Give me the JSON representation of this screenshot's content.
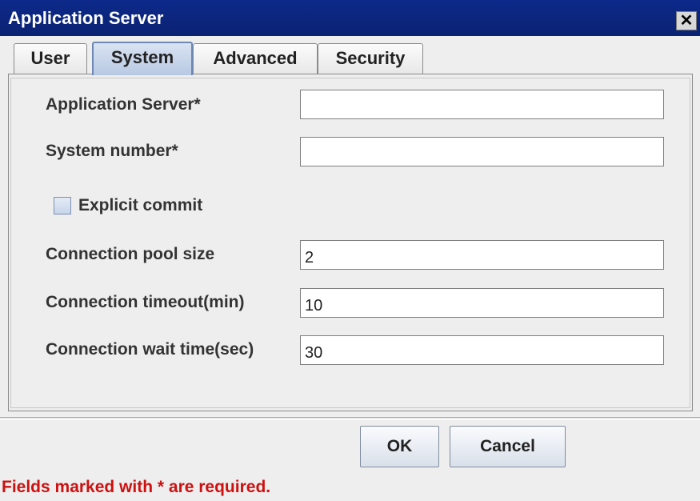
{
  "window": {
    "title": "Application Server",
    "close_glyph": "✕"
  },
  "tabs": [
    {
      "label": "User",
      "active": false
    },
    {
      "label": "System",
      "active": true
    },
    {
      "label": "Advanced",
      "active": false
    },
    {
      "label": "Security",
      "active": false
    }
  ],
  "form": {
    "application_server": {
      "label": "Application Server*",
      "value": ""
    },
    "system_number": {
      "label": "System number*",
      "value": ""
    },
    "explicit_commit": {
      "label": "Explicit commit",
      "checked": false
    },
    "connection_pool_size": {
      "label": "Connection pool size",
      "value": "2"
    },
    "connection_timeout": {
      "label": "Connection timeout(min)",
      "value": "10"
    },
    "connection_wait_time": {
      "label": "Connection wait time(sec)",
      "value": "30"
    }
  },
  "buttons": {
    "ok": "OK",
    "cancel": "Cancel"
  },
  "footer": {
    "required_note": "Fields marked with * are required."
  },
  "colors": {
    "titlebar": "#0d2a8a",
    "active_tab": "#b8c9e3",
    "required_note": "#cc1111"
  },
  "icons": {
    "close": "close-icon",
    "checkbox": "checkbox-unchecked"
  }
}
